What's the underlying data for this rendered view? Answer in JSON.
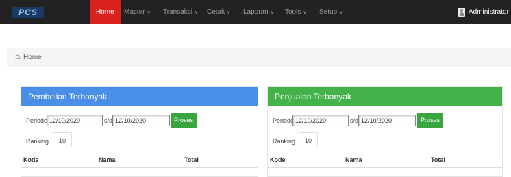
{
  "navbar": {
    "brand": "PCS",
    "items": [
      {
        "label": "Home",
        "active": true
      },
      {
        "label": "Master",
        "dropdown": true
      },
      {
        "label": "Transaksi",
        "dropdown": true
      },
      {
        "label": "Cetak",
        "dropdown": true
      },
      {
        "label": "Laporan",
        "dropdown": true
      },
      {
        "label": "Tools",
        "dropdown": true
      },
      {
        "label": "Setup",
        "dropdown": true
      }
    ],
    "user": "Administrator",
    "active_color": "#d9221c"
  },
  "breadcrumb": {
    "label": "Home"
  },
  "panels": {
    "pembelian": {
      "title": "Pembelian Terbanyak",
      "color": "#4a8fe7",
      "periode_label": "Periode",
      "date_from": "12/10/2020",
      "sd_label": "s/d",
      "date_to": "12/10/2020",
      "button": "Proses",
      "ranking_label": "Ranking",
      "ranking_value": "10",
      "columns": [
        "Kode",
        "Nama",
        "Total"
      ]
    },
    "penjualan": {
      "title": "Penjualan Terbanyak",
      "color": "#43b349",
      "periode_label": "Periode",
      "date_from": "12/10/2020",
      "sd_label": "s/d",
      "date_to": "12/10/2020",
      "button": "Proses",
      "ranking_label": "Ranking",
      "ranking_value": "10",
      "columns": [
        "Kode",
        "Nama",
        "Total"
      ]
    }
  }
}
